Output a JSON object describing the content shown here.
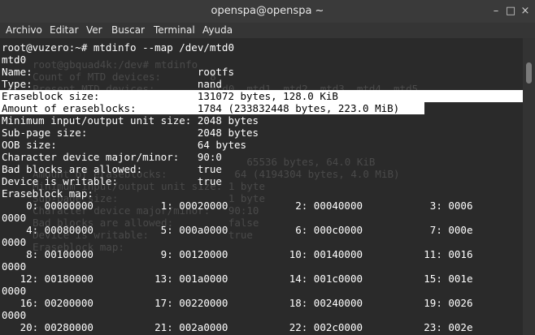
{
  "window": {
    "title": "openspa@openspa ~"
  },
  "menu": [
    "Archivo",
    "Editar",
    "Ver",
    "Buscar",
    "Terminal",
    "Ayuda"
  ],
  "terminal": {
    "lines": [
      "root@vuzero:~# mtdinfo --map /dev/mtd0",
      "mtd0",
      "Name:                           rootfs",
      "Type:                           nand",
      "Eraseblock size:                131072 bytes, 128.0 KiB",
      "Amount of eraseblocks:          1784 (233832448 bytes, 223.0 MiB)",
      "Minimum input/output unit size: 2048 bytes",
      "Sub-page size:                  2048 bytes",
      "OOB size:                       64 bytes",
      "Character device major/minor:   90:0",
      "Bad blocks are allowed:         true",
      "Device is writable:             true",
      "Eraseblock map:",
      "    0: 00000000           1: 00020000           2: 00040000           3: 0006",
      "0000",
      "    4: 00080000           5: 000a0000           6: 000c0000           7: 000e",
      "0000",
      "    8: 00100000           9: 00120000          10: 00140000          11: 0016",
      "0000",
      "   12: 00180000          13: 001a0000          14: 001c0000          15: 001e",
      "0000",
      "   16: 00200000          17: 00220000          18: 00240000          19: 0026",
      "0000",
      "   20: 00280000          21: 002a0000          22: 002c0000          23: 002e"
    ],
    "ghost": [
      "root@gbquad4k:/dev# mtdinfo",
      "Count of MTD devices:        8",
      "Present MTD devices:         mtd0, mtd1, mtd2, mtd3, mtd4, mtd5",
      "",
      "",
      "",
      "",
      "",
      "",
      "                                   65536 bytes, 64.0 KiB",
      "Amount of eraseblocks:           64 (4194304 bytes, 4.0 MiB)",
      "Minimum input/output unit size: 1 byte",
      "Sub-page size:                  1 byte",
      "Character device major/minor:   90:10",
      "Bad blocks are allowed:         false",
      "Device is writable:             true",
      "Eraseblock map:"
    ]
  }
}
